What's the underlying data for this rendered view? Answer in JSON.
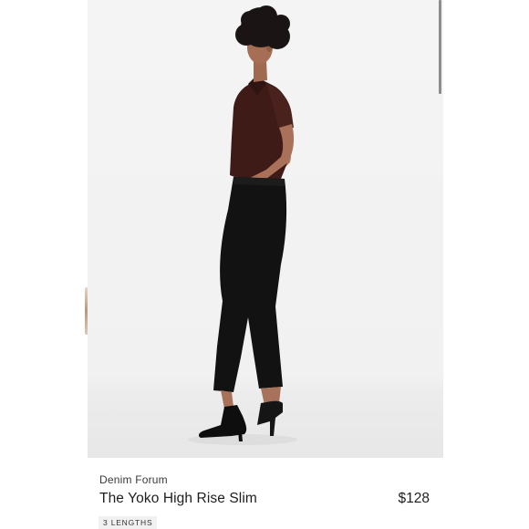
{
  "product": {
    "brand": "Denim Forum",
    "name": "The Yoko High Rise Slim",
    "price": "$128",
    "badge": "3 LENGTHS"
  },
  "image": {
    "subject": "model-in-black-jeans-and-brown-shirt"
  },
  "colors": {
    "background": "#ffffff",
    "photo_backdrop": "#f2f2f2",
    "text_primary": "#1e1e1e",
    "text_secondary": "#3a3a3a",
    "badge_bg": "#f1f1f1",
    "scroll_indicator": "#8d8d8d"
  }
}
